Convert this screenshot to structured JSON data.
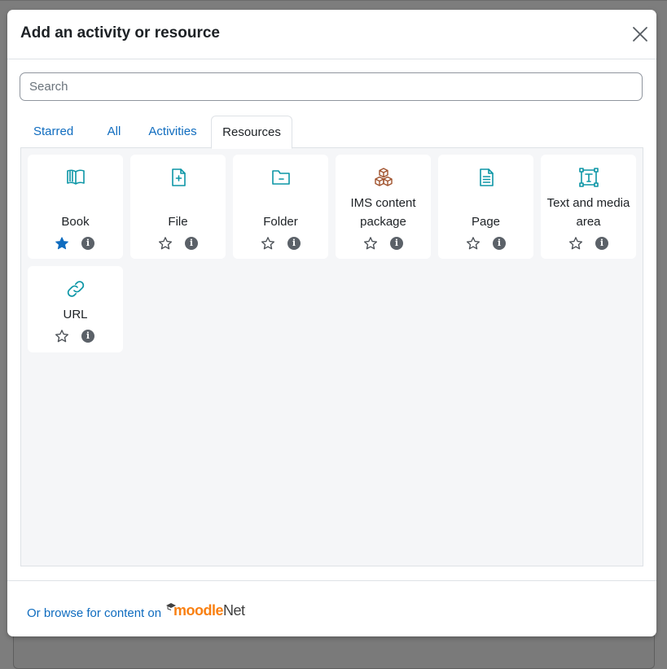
{
  "modal": {
    "title": "Add an activity or resource",
    "close_label": "Close"
  },
  "search": {
    "placeholder": "Search",
    "value": ""
  },
  "tabs": [
    {
      "label": "Starred",
      "active": false
    },
    {
      "label": "All",
      "active": false
    },
    {
      "label": "Activities",
      "active": false
    },
    {
      "label": "Resources",
      "active": true
    }
  ],
  "items": [
    {
      "label": "Book",
      "icon": "book-icon",
      "starred": true
    },
    {
      "label": "File",
      "icon": "file-icon",
      "starred": false
    },
    {
      "label": "Folder",
      "icon": "folder-icon",
      "starred": false
    },
    {
      "label": "IMS content package",
      "icon": "ims-package-icon",
      "starred": false
    },
    {
      "label": "Page",
      "icon": "page-icon",
      "starred": false
    },
    {
      "label": "Text and media area",
      "icon": "text-media-icon",
      "starred": false
    },
    {
      "label": "URL",
      "icon": "link-icon",
      "starred": false
    }
  ],
  "footer": {
    "browse_text": "Or browse for content on",
    "logo_moodle": "moodle",
    "logo_net": "Net"
  },
  "colors": {
    "link": "#0f6cbf",
    "icon_teal": "#0d96a6",
    "icon_brown": "#a0522d",
    "star_filled": "#0f6cbf",
    "moodle_orange": "#f98012"
  }
}
